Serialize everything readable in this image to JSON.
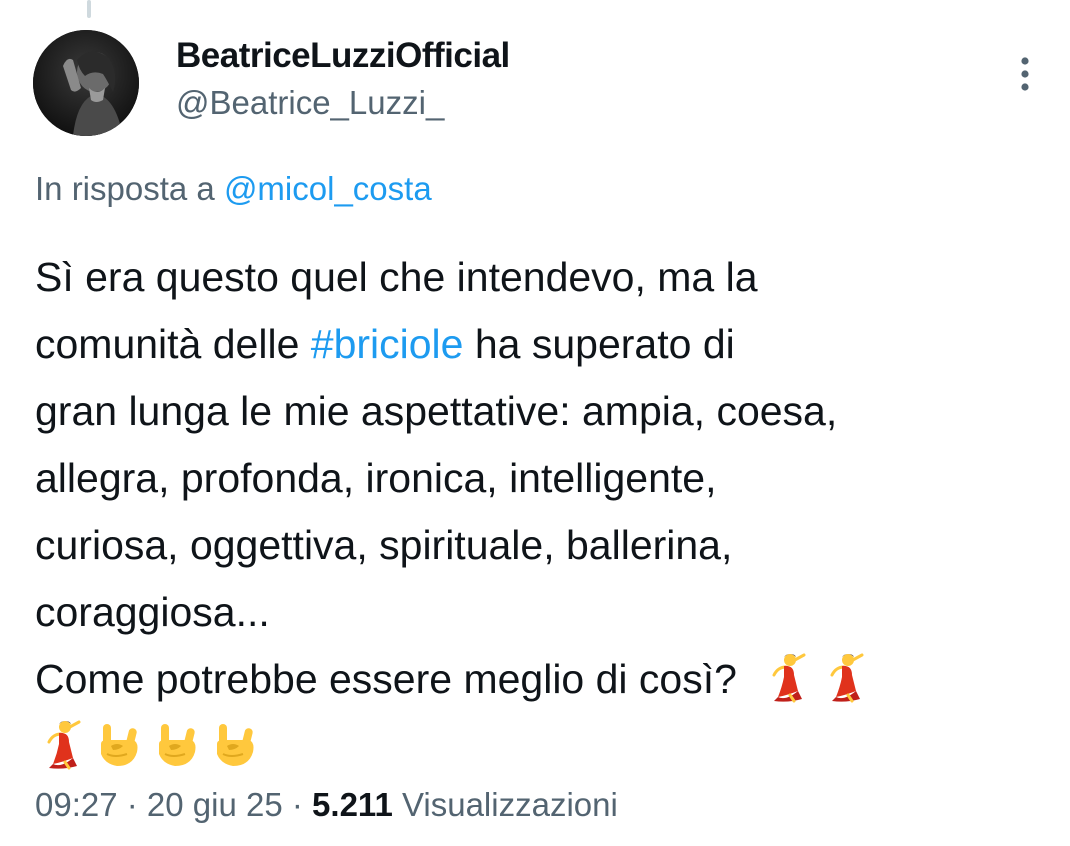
{
  "author": {
    "display_name": "BeatriceLuzziOfficial",
    "handle": "@Beatrice_Luzzi_",
    "avatar_icon": "profile-photo"
  },
  "more_icon": "vertical-ellipsis-icon",
  "reply": {
    "prefix": "In risposta a ",
    "mention": "@micol_costa"
  },
  "tweet": {
    "line1": "Sì era questo quel che intendevo, ma la",
    "line2_before": "comunità delle ",
    "hashtag": "#briciole",
    "line2_after": " ha superato di",
    "line3": "gran lunga le mie aspettative: ampia, coesa,",
    "line4": "allegra, profonda, ironica, intelligente,",
    "line5": "curiosa, oggettiva, spirituale, ballerina,",
    "line6": "coraggiosa...",
    "line7": "Come potrebbe essere meglio di così?",
    "emoji_line7": [
      "dancing-woman-emoji",
      "dancing-woman-emoji"
    ],
    "emoji_line8": [
      "dancing-woman-emoji",
      "rock-on-hand-emoji",
      "rock-on-hand-emoji",
      "rock-on-hand-emoji"
    ]
  },
  "meta": {
    "time": "09:27",
    "sep1": " · ",
    "date": "20 giu 25",
    "sep2": " · ",
    "views_count": "5.211",
    "views_label": " Visualizzazioni"
  },
  "colors": {
    "link": "#1d9bf0",
    "secondary_text": "#536471",
    "primary_text": "#0f1419",
    "thread_line": "#cfd9de"
  }
}
